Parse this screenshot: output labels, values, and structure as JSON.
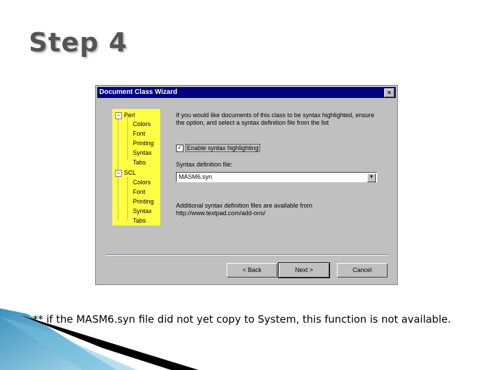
{
  "slide": {
    "title": "Step 4",
    "caption": "** if the MASM6.syn file did not yet copy to System, this function is not available."
  },
  "dialog": {
    "title": "Document Class Wizard",
    "close_glyph": "×",
    "tree": {
      "groups": [
        {
          "label": "Perl",
          "expand_glyph": "−",
          "children": [
            "Colors",
            "Font",
            "Printing",
            "Syntax",
            "Tabs"
          ]
        },
        {
          "label": "SCL",
          "expand_glyph": "−",
          "children": [
            "Colors",
            "Font",
            "Printing",
            "Syntax",
            "Tabs"
          ]
        }
      ]
    },
    "intro_text": "If you would like documents of this class to be syntax highlighted, ensure the option, and select a syntax definition file from the list",
    "enable_checkbox": {
      "label": "Enable syntax highlighting",
      "checked_glyph": "✓"
    },
    "syntax_label": "Syntax definition file:",
    "syntax_select": {
      "value": "MASM6.syn",
      "arrow_glyph": "▼"
    },
    "additional_text_1": "Additional syntax definition files are available from",
    "additional_text_2": "http://www.textpad.com/add-ons/",
    "buttons": {
      "back": "< Back",
      "next": "Next >",
      "cancel": "Cancel"
    }
  }
}
